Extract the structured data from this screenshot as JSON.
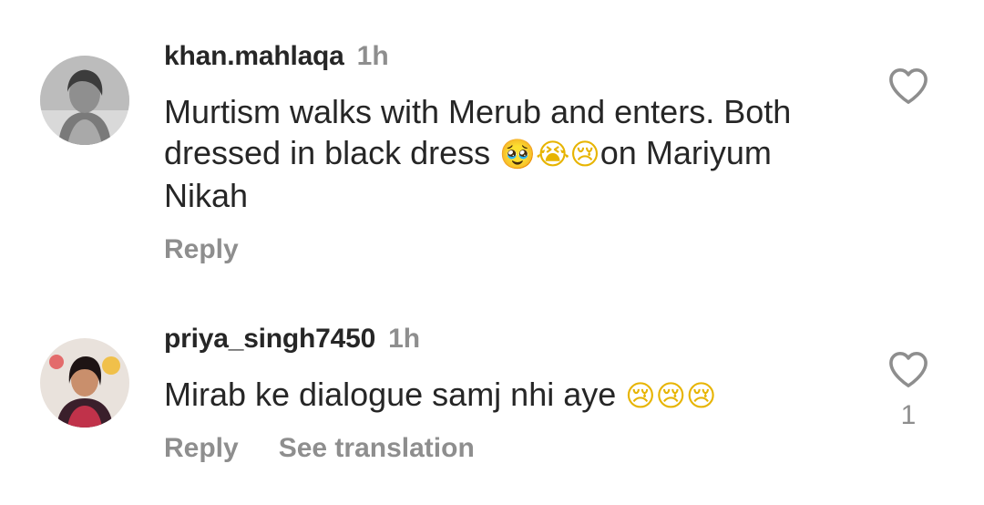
{
  "comments": [
    {
      "username": "khan.mahlaqa",
      "time": "1h",
      "text_lines": [
        "Murtism walks with Merub and enters. Both",
        "dressed in black dress ",
        "on Mariyum",
        "Nikah"
      ],
      "emojis": [
        "🥹",
        "😭",
        "😢"
      ],
      "reply_label": "Reply",
      "like_count": ""
    },
    {
      "username": "priya_singh7450",
      "time": "1h",
      "text": "Mirab ke dialogue samj nhi aye ",
      "emojis": [
        "😢",
        "😢",
        "😢"
      ],
      "reply_label": "Reply",
      "translate_label": "See translation",
      "like_count": "1"
    }
  ],
  "icons": {
    "like": "heart-outline-icon"
  }
}
